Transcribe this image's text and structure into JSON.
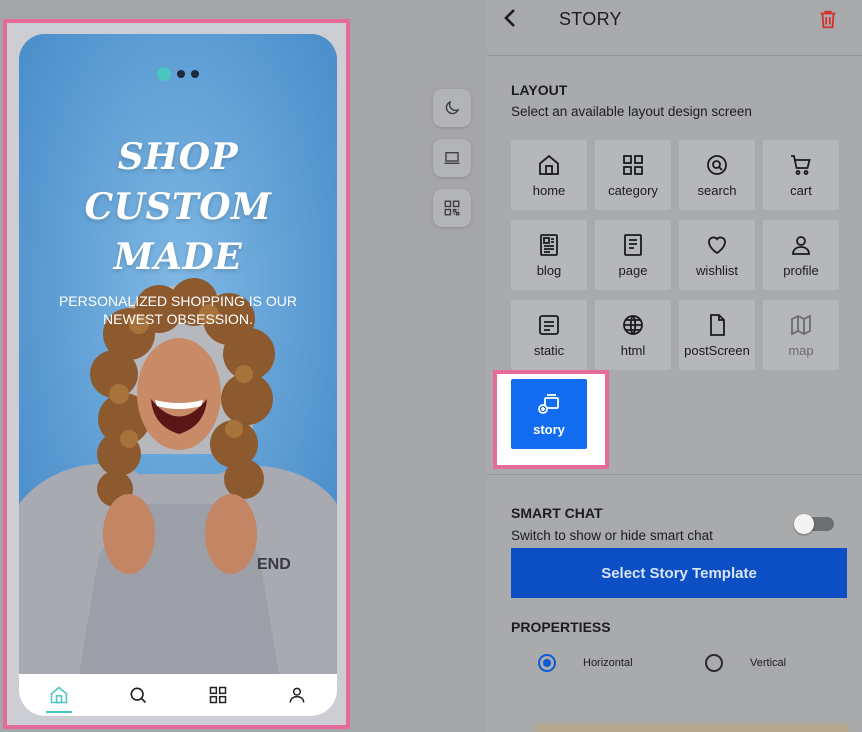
{
  "preview": {
    "title_line1": "SHOP CUSTOM",
    "title_line2": "MADE",
    "subtitle_line1": "PERSONALIZED SHOPPING IS OUR",
    "subtitle_line2": "NEWEST OBSESSION.",
    "carousel": {
      "count": 3,
      "active": 0
    },
    "bottom_nav": [
      {
        "icon": "home-icon",
        "active": true
      },
      {
        "icon": "search-icon",
        "active": false
      },
      {
        "icon": "grid-icon",
        "active": false
      },
      {
        "icon": "user-icon",
        "active": false
      }
    ],
    "accent_color": "#4ac6c0"
  },
  "side_tools": [
    {
      "icon": "moon-icon"
    },
    {
      "icon": "laptop-icon"
    },
    {
      "icon": "qr-code-icon"
    }
  ],
  "panel": {
    "title": "STORY",
    "layout": {
      "heading": "LAYOUT",
      "description": "Select an available layout design screen",
      "tiles": [
        {
          "label": "home",
          "icon": "home-icon",
          "disabled": false
        },
        {
          "label": "category",
          "icon": "grid-icon",
          "disabled": false
        },
        {
          "label": "search",
          "icon": "search-icon",
          "disabled": false
        },
        {
          "label": "cart",
          "icon": "cart-icon",
          "disabled": false
        },
        {
          "label": "blog",
          "icon": "blog-icon",
          "disabled": false
        },
        {
          "label": "page",
          "icon": "page-icon",
          "disabled": false
        },
        {
          "label": "wishlist",
          "icon": "heart-icon",
          "disabled": false
        },
        {
          "label": "profile",
          "icon": "user-icon",
          "disabled": false
        },
        {
          "label": "static",
          "icon": "static-icon",
          "disabled": false
        },
        {
          "label": "html",
          "icon": "globe-icon",
          "disabled": false
        },
        {
          "label": "postScreen",
          "icon": "document-icon",
          "disabled": false
        },
        {
          "label": "map",
          "icon": "map-icon",
          "disabled": true
        }
      ],
      "selected": {
        "label": "story",
        "icon": "story-icon"
      }
    },
    "smart_chat": {
      "heading": "SMART CHAT",
      "description": "Switch to show or hide smart chat",
      "enabled": false
    },
    "cta_label": "Select Story Template",
    "properties": {
      "heading": "PROPERTIESS",
      "options": [
        {
          "label": "Horizontal",
          "checked": true
        },
        {
          "label": "Vertical",
          "checked": false
        }
      ]
    },
    "colors": {
      "primary": "#116cf0",
      "cta": "#0c4fc4",
      "delete": "#d0332f",
      "highlight": "#e56b9a"
    }
  }
}
